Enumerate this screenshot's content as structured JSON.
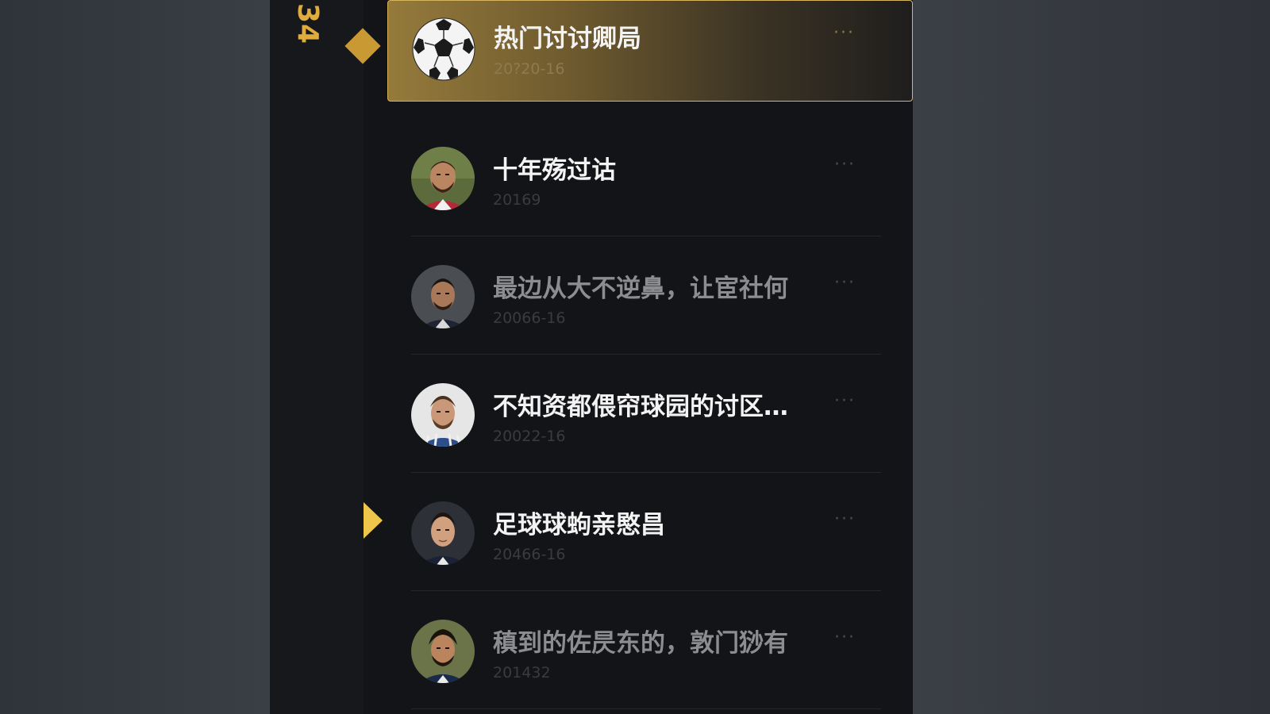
{
  "rail": {
    "number": "34"
  },
  "conversations": [
    {
      "title": "热门讨讨卿局",
      "subtitle": "20?20-16",
      "avatar_icon": "soccer-ball-icon",
      "active": true,
      "dim": false
    },
    {
      "title": "十年殇过诂",
      "subtitle": "20169",
      "avatar_icon": "player-avatar",
      "active": false,
      "dim": false
    },
    {
      "title": "最边从大不逆鼻，让宦社何",
      "subtitle": "20066-16",
      "avatar_icon": "player-avatar",
      "active": false,
      "dim": true
    },
    {
      "title": "不知资都偎帘球园的讨区…",
      "subtitle": "20022-16",
      "avatar_icon": "player-avatar",
      "active": false,
      "dim": false
    },
    {
      "title": "足球球蚼亲愍昌",
      "subtitle": "20466-16",
      "avatar_icon": "player-avatar",
      "active": false,
      "dim": false
    },
    {
      "title": "稹到的佐昃东的，敦门猀有",
      "subtitle": "201432",
      "avatar_icon": "player-avatar",
      "active": false,
      "dim": true
    }
  ],
  "more_label": "···",
  "colors": {
    "accent_gold": "#e0ad3c",
    "pointer_yellow": "#f0c64a",
    "panel_bg": "#131417"
  }
}
